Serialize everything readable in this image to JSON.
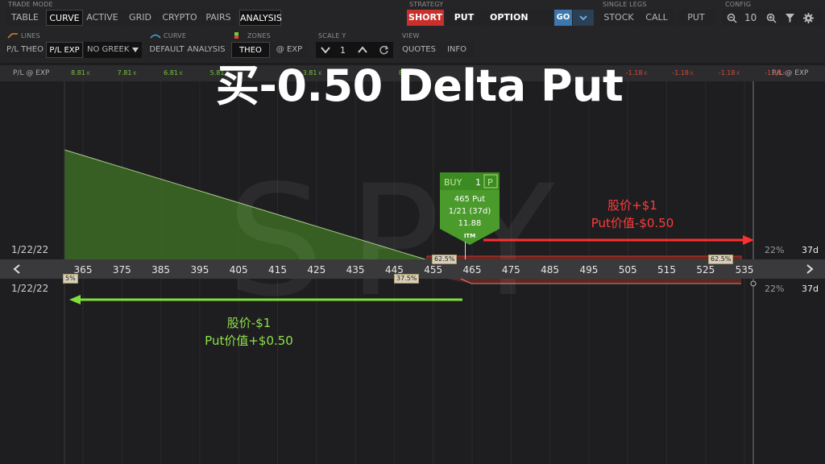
{
  "header": {
    "trade_mode_label": "TRADE MODE",
    "trade_modes": [
      "TABLE",
      "CURVE",
      "ACTIVE",
      "GRID",
      "CRYPTO",
      "PAIRS",
      "ANALYSIS"
    ],
    "strategy_label": "STRATEGY",
    "strategy_side": "SHORT",
    "strategy_type": "PUT",
    "strategy_instrument": "OPTION",
    "go_label": "GO",
    "single_legs_label": "SINGLE LEGS",
    "single_legs": [
      "STOCK",
      "CALL",
      "PUT"
    ],
    "config_label": "CONFIG",
    "zoom_value": "10"
  },
  "subbar": {
    "lines_label": "LINES",
    "lines_options": [
      "P/L THEO",
      "P/L EXP"
    ],
    "greek_select": "NO GREEK",
    "curve_label": "CURVE",
    "curve_options": [
      "DEFAULT",
      "ANALYSIS"
    ],
    "zones_label": "ZONES",
    "zones_options": [
      "THEO",
      "@ EXP"
    ],
    "scale_label": "SCALE Y",
    "scale_value": "1",
    "view_label": "VIEW",
    "view_options": [
      "QUOTES",
      "INFO"
    ]
  },
  "pl_row": {
    "left_label": "P/L @ EXP",
    "right_label": "P/L @ EXP",
    "values": [
      {
        "v": "8.81",
        "u": "K",
        "s": "pos"
      },
      {
        "v": "7.81",
        "u": "K",
        "s": "pos"
      },
      {
        "v": "6.81",
        "u": "K",
        "s": "pos"
      },
      {
        "v": "5.81",
        "u": "K",
        "s": "pos"
      },
      {
        "v": "",
        "u": "",
        "s": "pos"
      },
      {
        "v": "3.81",
        "u": "K",
        "s": "pos"
      },
      {
        "v": "",
        "u": "",
        "s": "pos"
      },
      {
        "v": "812",
        "u": "",
        "s": "pos"
      },
      {
        "v": "",
        "u": "",
        "s": "neg"
      },
      {
        "v": "",
        "u": "",
        "s": "neg"
      },
      {
        "v": "",
        "u": "",
        "s": "neg"
      },
      {
        "v": "",
        "u": "",
        "s": "neg"
      },
      {
        "v": "-1.18",
        "u": "K",
        "s": "neg"
      },
      {
        "v": "-1.18",
        "u": "K",
        "s": "neg"
      },
      {
        "v": "-1.18",
        "u": "K",
        "s": "neg"
      },
      {
        "v": "-1.18",
        "u": "K",
        "s": "neg"
      }
    ]
  },
  "title": "买-0.50 Delta Put",
  "watermark": "SPY",
  "axis": {
    "ticks": [
      "365",
      "375",
      "385",
      "395",
      "405",
      "415",
      "425",
      "435",
      "445",
      "455",
      "465",
      "475",
      "485",
      "495",
      "505",
      "515",
      "525",
      "535"
    ],
    "date_top": "1/22/22",
    "date_bottom": "1/22/22",
    "pct_top": "22%",
    "pct_bottom": "22%",
    "days_top": "37d",
    "days_bottom": "37d",
    "prob_markers": [
      "62.5%",
      "62.5%",
      "37.5%",
      "5%"
    ]
  },
  "order": {
    "side": "BUY",
    "qty": "1",
    "type_badge": "P",
    "line1": "465 Put",
    "line2": "1/21 (37d)",
    "price": "11.88",
    "moneyness": "ITM"
  },
  "annotations": {
    "red_line1": "股价+$1",
    "red_line2": "Put价值-$0.50",
    "green_line1": "股价-$1",
    "green_line2": "Put价值+$0.50"
  },
  "colors": {
    "accent_red": "#ff3b3b",
    "accent_green": "#8ee04a",
    "short_button": "#c9302c",
    "go_button": "#3c78b0"
  }
}
